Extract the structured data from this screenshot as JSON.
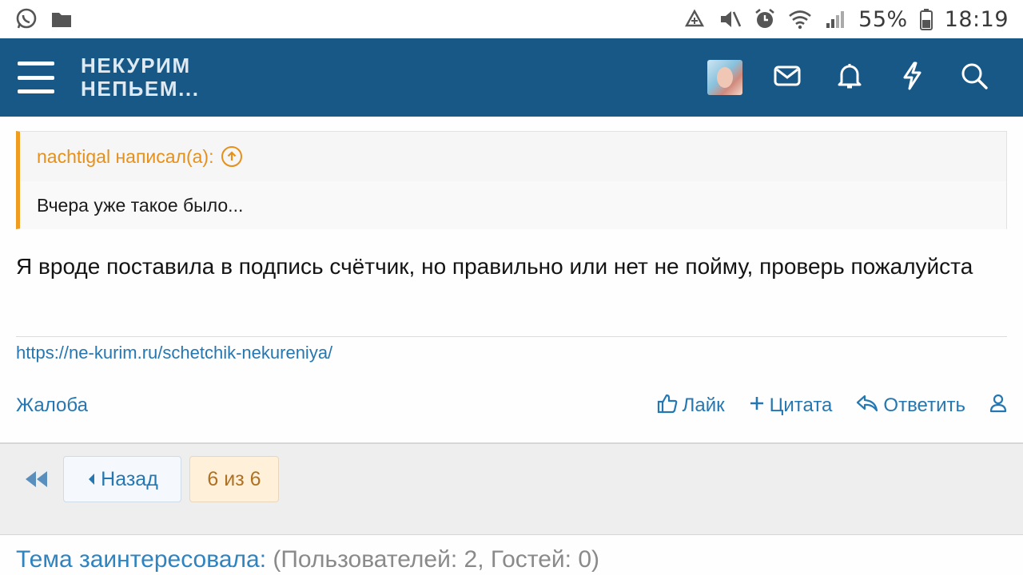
{
  "status_bar": {
    "battery": "55%",
    "time": "18:19",
    "left_icons": [
      "whatsapp-icon",
      "folder-icon"
    ],
    "right_icons": [
      "data-saver-icon",
      "mute-icon",
      "alarm-icon",
      "wifi-icon",
      "signal-icon",
      "battery-icon"
    ]
  },
  "header": {
    "logo_line1": "НЕКУРИМ",
    "logo_line2": "НЕПЬЕМ...",
    "bg_color": "#185886",
    "actions": [
      "avatar",
      "inbox-icon",
      "bell-icon",
      "lightning-icon",
      "search-icon"
    ]
  },
  "post": {
    "quote_author": "nachtigal написал(а):",
    "quote_text": "Вчера уже такое было...",
    "text": "Я вроде поставила в подпись счётчик, но правильно или нет не пойму, проверь пожалуйста",
    "signature_link": "https://ne-kurim.ru/schetchik-nekureniya/",
    "report_label": "Жалоба",
    "like_label": "Лайк",
    "quote_label": "Цитата",
    "reply_label": "Ответить",
    "accent_color": "#f09c1f",
    "link_color": "#2577b1"
  },
  "pagination": {
    "back_label": "Назад",
    "current": "6 из 6"
  },
  "footer": {
    "interested_label": "Тема заинтересовала:",
    "interested_counts": "(Пользователей: 2, Гостей: 0)"
  }
}
